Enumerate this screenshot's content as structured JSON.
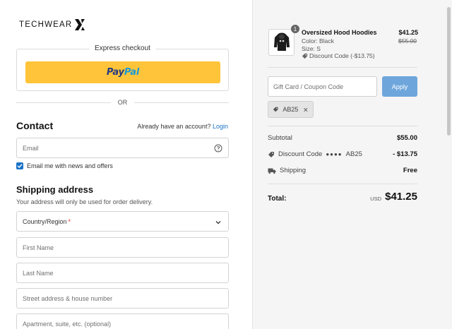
{
  "brand": {
    "name": "TECHWEAR"
  },
  "express": {
    "label": "Express checkout",
    "paypal_pay": "Pay",
    "paypal_pal": "Pal"
  },
  "or_text": "OR",
  "contact": {
    "heading": "Contact",
    "account_prompt": "Already have an account?",
    "login_link": "Login",
    "email_placeholder": "Email",
    "newsletter_label": "Email me with news and offers",
    "newsletter_checked": true
  },
  "shipping": {
    "heading": "Shipping address",
    "subtitle": "Your address will only be used for order delivery.",
    "country_label": "Country/Region",
    "required_mark": "*",
    "first_name": "First Name",
    "last_name": "Last Name",
    "street": "Street address & house number",
    "apartment": "Apartment, suite, etc. (optional)"
  },
  "cart": {
    "item": {
      "quantity": "1",
      "name": "Oversized Hood Hoodies",
      "color": "Color: Black",
      "size": "Size: S",
      "discount": "Discount Code (-$13.75)",
      "price": "$41.25",
      "original_price": "$55.00"
    }
  },
  "coupon": {
    "placeholder": "Gift Card / Coupon Code",
    "apply_label": "Apply",
    "applied_code": "AB25"
  },
  "summary": {
    "subtotal_label": "Subtotal",
    "subtotal_value": "$55.00",
    "discount_label": "Discount Code",
    "discount_dots": "●●●●",
    "discount_code": "AB25",
    "discount_value": "- $13.75",
    "shipping_label": "Shipping",
    "shipping_value": "Free",
    "total_label": "Total:",
    "total_currency": "USD",
    "total_value": "$41.25"
  },
  "colors": {
    "paypal_yellow": "#ffc439",
    "accent_blue": "#1a73c8",
    "apply_button": "#6ea6dc",
    "summary_bg": "#f5f5f5"
  }
}
